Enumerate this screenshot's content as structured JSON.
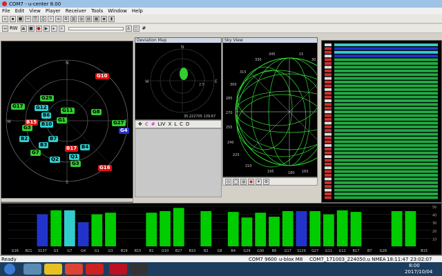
{
  "window": {
    "title": "COM7 - u-center 8.00"
  },
  "menu": [
    "File",
    "Edit",
    "View",
    "Player",
    "Receiver",
    "Tools",
    "Window",
    "Help"
  ],
  "toolbar": {
    "speed_label": "RW",
    "checkbox_label": "#"
  },
  "panels": {
    "deviation_title": "Deviation Map",
    "deviation_labels": {
      "n": "N",
      "w": "W",
      "e": "E",
      "s": "S",
      "coords": "35.222705 139.67",
      "scale": "2.5"
    },
    "deviation_toolbar": [
      "LIV",
      "X",
      "L",
      "C",
      "D"
    ],
    "sky_title": "Sky View",
    "sky_labels": [
      "345",
      "330",
      "315",
      "300",
      "285",
      "270",
      "255",
      "240",
      "225",
      "210",
      "195",
      "180",
      "165",
      "15",
      "30"
    ],
    "polar_labels": {
      "n": "N",
      "w": "W",
      "e": "E",
      "s": "S"
    }
  },
  "satellites": [
    {
      "id": "G10",
      "color": "#d11"
    },
    {
      "id": "G29",
      "color": "#3c3"
    },
    {
      "id": "G12",
      "color": "#3cc"
    },
    {
      "id": "G11",
      "color": "#3c3"
    },
    {
      "id": "G8",
      "color": "#3c3"
    },
    {
      "id": "G17",
      "color": "#3c3"
    },
    {
      "id": "G27",
      "color": "#3c3"
    },
    {
      "id": "G4",
      "color": "#23c"
    },
    {
      "id": "B6",
      "color": "#3cc"
    },
    {
      "id": "B15",
      "color": "#d11"
    },
    {
      "id": "B10",
      "color": "#3cc"
    },
    {
      "id": "G1",
      "color": "#3c3"
    },
    {
      "id": "G3",
      "color": "#3c3"
    },
    {
      "id": "B2",
      "color": "#3cc"
    },
    {
      "id": "B7",
      "color": "#3cc"
    },
    {
      "id": "B3",
      "color": "#3cc"
    },
    {
      "id": "B17",
      "color": "#d11"
    },
    {
      "id": "B4",
      "color": "#3cc"
    },
    {
      "id": "G7",
      "color": "#3c3"
    },
    {
      "id": "Q2",
      "color": "#3cc"
    },
    {
      "id": "Q1",
      "color": "#3cc"
    },
    {
      "id": "G3",
      "color": "#3c3"
    },
    {
      "id": "G16",
      "color": "#d11"
    }
  ],
  "chart_data": {
    "type": "bar",
    "categories": [
      "G16",
      "B21",
      "S137",
      "G3",
      "G7",
      "G4",
      "G1",
      "G3",
      "B19",
      "B15",
      "B1",
      "G10",
      "B27",
      "B10",
      "B2",
      "G8",
      "B4",
      "G29",
      "G30",
      "B6",
      "G17",
      "S129",
      "G27",
      "G11",
      "G12",
      "B17",
      "B7",
      "G28",
      "",
      "",
      "B15"
    ],
    "values": [
      0,
      0,
      40,
      45,
      45,
      30,
      40,
      42,
      0,
      0,
      42,
      44,
      48,
      0,
      44,
      0,
      43,
      36,
      42,
      37,
      44,
      44,
      44,
      40,
      45,
      43,
      0,
      0,
      44,
      44,
      0
    ],
    "colors": [
      "#0c0",
      "#0c0",
      "#23c",
      "#0c0",
      "#3cc",
      "#23c",
      "#0c0",
      "#0c0",
      "#0c0",
      "#0c0",
      "#0c0",
      "#0c0",
      "#0c0",
      "#0c0",
      "#0c0",
      "#0c0",
      "#0c0",
      "#0c0",
      "#0c0",
      "#0c0",
      "#0c0",
      "#23c",
      "#0c0",
      "#0c0",
      "#0c0",
      "#0c0",
      "#0c0",
      "#0c0",
      "#0c0",
      "#0c0",
      "#0c0"
    ],
    "ylim": [
      0,
      50
    ],
    "yticks": [
      "50",
      "40",
      "30",
      "20",
      "10"
    ]
  },
  "status": {
    "ready": "Ready",
    "port": "COM7 9600",
    "receiver": "u-blox M8",
    "file": "COM7_171003_224050.u NMEA",
    "time1": "18:11:47",
    "time2": "23:02:07"
  },
  "tray": {
    "time": "8:00",
    "date": "2017/10/04"
  }
}
